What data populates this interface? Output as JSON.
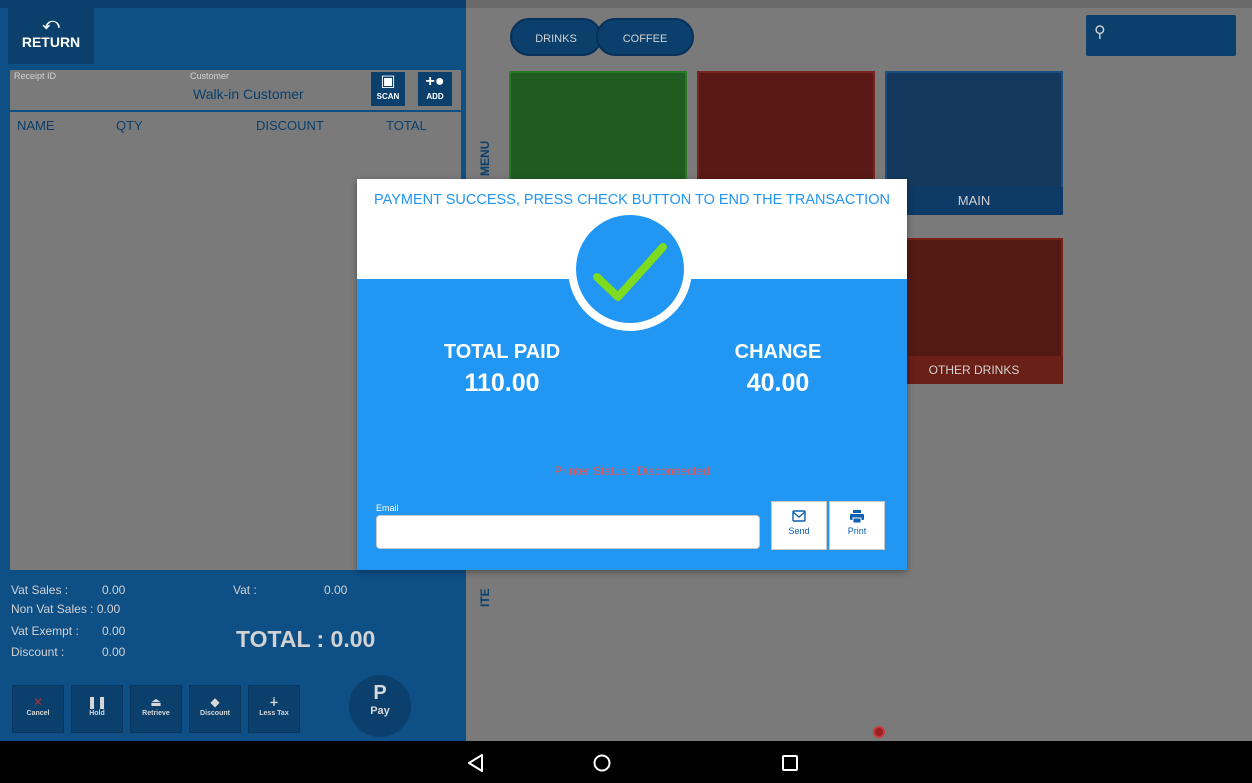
{
  "left_panel": {
    "return_label": "RETURN",
    "receipt_label": "Receipt ID",
    "customer_label": "Customer",
    "customer_value": "Walk-in Customer",
    "scan_label": "SCAN",
    "add_label": "ADD",
    "table_headers": [
      "NAME",
      "QTY",
      "DISCOUNT",
      "TOTAL"
    ],
    "summary": {
      "vat_sales_label": "Vat Sales :",
      "vat_sales_value": "0.00",
      "vat_label": "Vat :",
      "vat_value": "0.00",
      "non_vat_sales": "Non Vat Sales : 0.00",
      "vat_exempt_label": "Vat Exempt :",
      "vat_exempt_value": "0.00",
      "discount_label": "Discount :",
      "discount_value": "0.00",
      "total": "TOTAL : 0.00"
    },
    "actions": {
      "cancel": "Cancel",
      "hold": "Hold",
      "retrieve": "Retrieve",
      "discount": "Discount",
      "less_tax": "Less Tax",
      "pay_glyph": "P",
      "pay": "Pay"
    }
  },
  "right_panel": {
    "tabs": [
      "DRINKS",
      "COFFEE"
    ],
    "menu_label": "MENU",
    "items_label": "ITE",
    "tiles": {
      "main": "MAIN",
      "other_drinks": "OTHER DRINKS"
    }
  },
  "modal": {
    "message": "PAYMENT SUCCESS, PRESS CHECK BUTTON TO END THE TRANSACTION",
    "total_paid_label": "TOTAL PAID",
    "total_paid_value": "110.00",
    "change_label": "CHANGE",
    "change_value": "40.00",
    "printer_status": "Printer Status : Disconnected",
    "email_label": "Email",
    "email_value": "",
    "send_label": "Send",
    "print_label": "Print"
  },
  "colors": {
    "modal_blue": "#2196f3",
    "check_green": "#7ddc1f",
    "printer_status_red": "#e8524b"
  }
}
